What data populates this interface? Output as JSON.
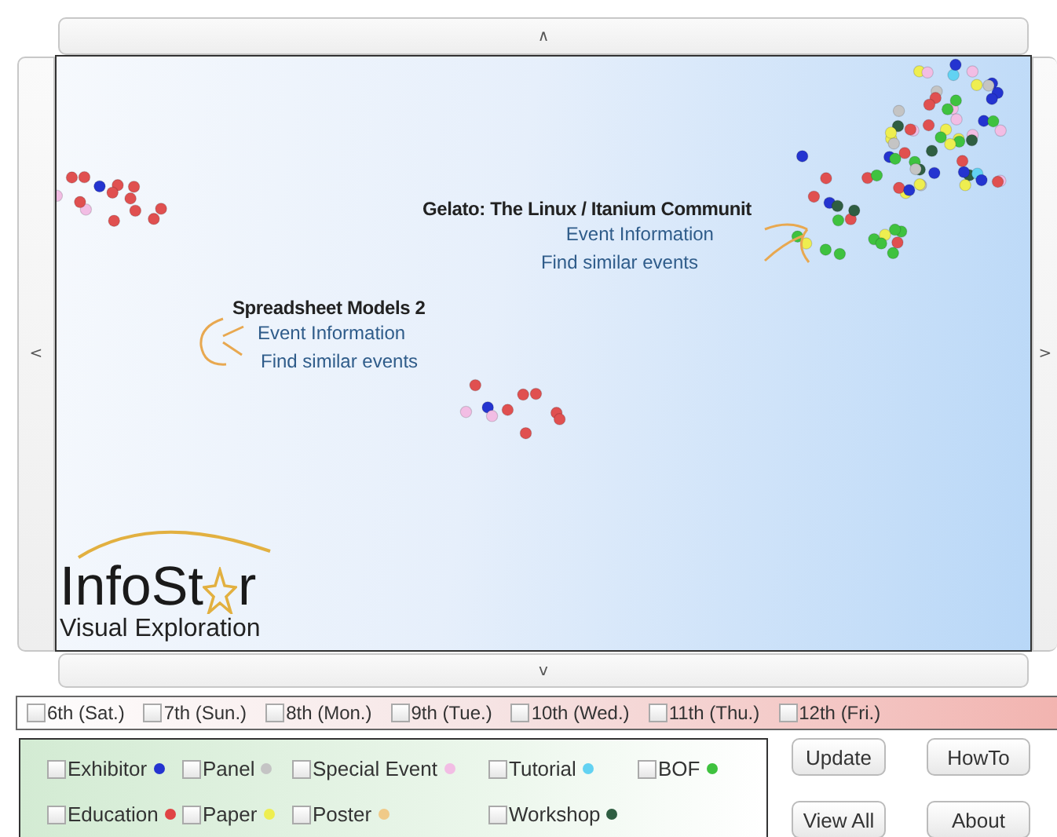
{
  "scroll_buttons": {
    "up": "∧",
    "left": "<",
    "right": ">",
    "down": "v"
  },
  "popups": [
    {
      "title": "Gelato: The Linux / Itanium Communit",
      "links": [
        "Event Information",
        "Find similar events"
      ]
    },
    {
      "title": "Spreadsheet Models 2",
      "links": [
        "Event Information",
        "Find similar events"
      ]
    }
  ],
  "logo": {
    "before": "InfoSt",
    "after": "r",
    "subtitle": "Visual Exploration"
  },
  "days": [
    {
      "label": "6th (Sat.)",
      "checked": false
    },
    {
      "label": "7th (Sun.)",
      "checked": false
    },
    {
      "label": "8th (Mon.)",
      "checked": false
    },
    {
      "label": "9th (Tue.)",
      "checked": false
    },
    {
      "label": "10th (Wed.)",
      "checked": false
    },
    {
      "label": "11th (Thu.)",
      "checked": false
    },
    {
      "label": "12th (Fri.)",
      "checked": false
    }
  ],
  "categories": [
    {
      "label": "Exhibitor",
      "checked": false,
      "color": "#2434d0"
    },
    {
      "label": "Panel",
      "checked": false,
      "color": "#c4c4c4"
    },
    {
      "label": "Special Event",
      "checked": false,
      "color": "#f2bde4"
    },
    {
      "label": "Tutorial",
      "checked": false,
      "color": "#62d2f2"
    },
    {
      "label": "BOF",
      "checked": false,
      "color": "#3fc23f"
    },
    {
      "label": "Education",
      "checked": false,
      "color": "#e04444"
    },
    {
      "label": "Paper",
      "checked": false,
      "color": "#eeee50"
    },
    {
      "label": "Poster",
      "checked": false,
      "color": "#f0ca88"
    },
    {
      "label": "Workshop",
      "checked": false,
      "color": "#2f5e42"
    }
  ],
  "buttons": [
    "Update",
    "HowTo",
    "View All",
    "About"
  ]
}
